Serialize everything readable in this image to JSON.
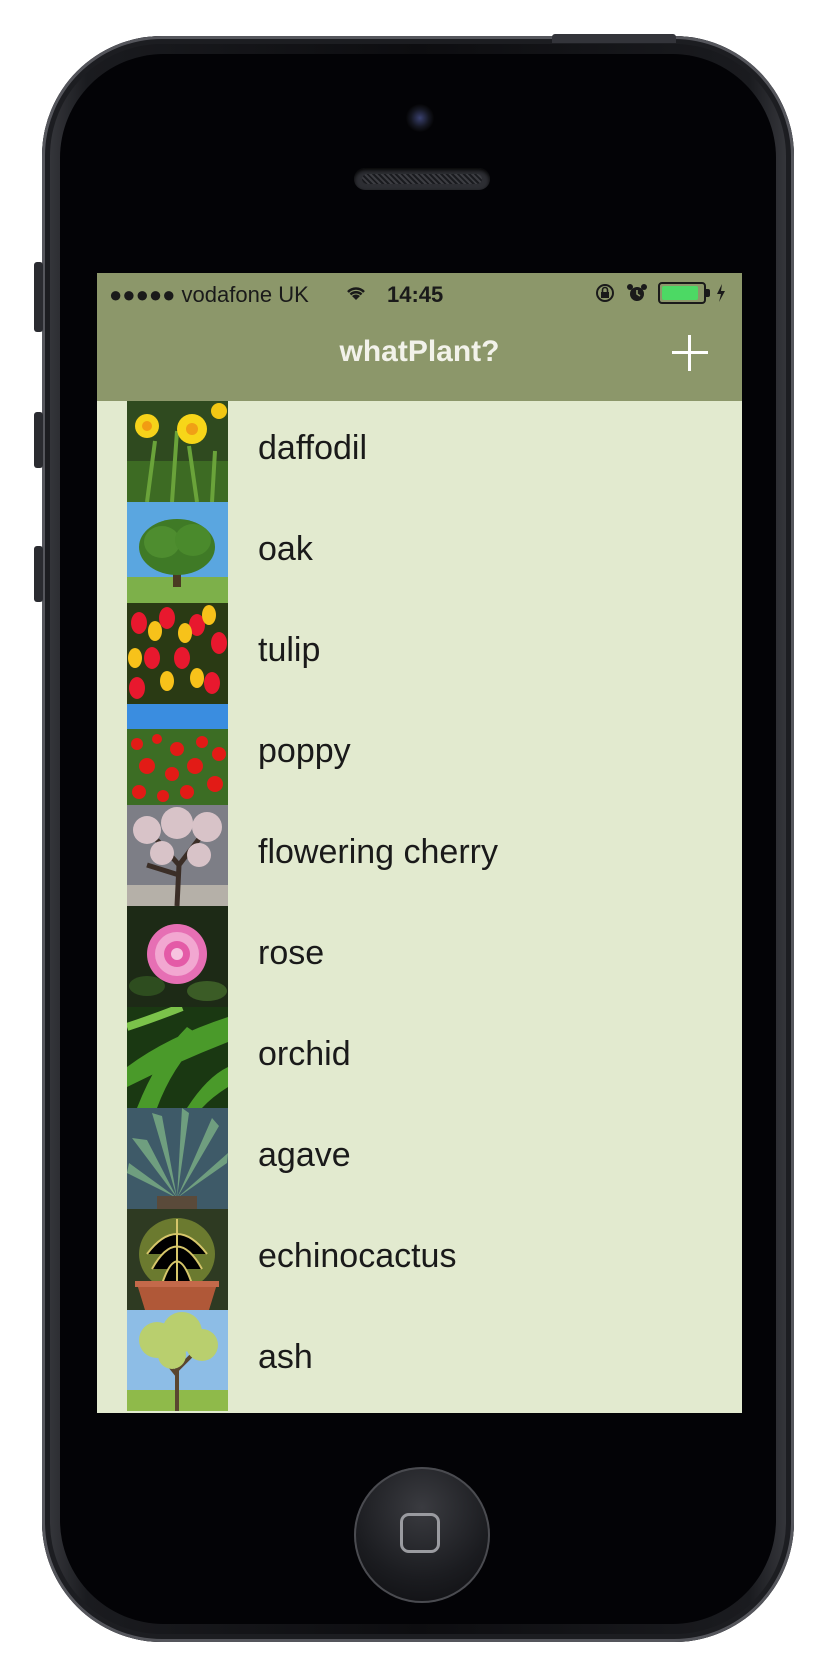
{
  "status_bar": {
    "carrier": "●●●●● vodafone UK",
    "time": "14:45",
    "battery_level": 0.9
  },
  "nav": {
    "title": "whatPlant?",
    "add_icon": "plus-icon"
  },
  "colors": {
    "bar": "#8c976a",
    "list_bg": "#e2eacf",
    "battery_green": "#4cd964"
  },
  "plants": [
    {
      "label": "daffodil",
      "icon": "daffodil-photo"
    },
    {
      "label": "oak",
      "icon": "oak-photo"
    },
    {
      "label": "tulip",
      "icon": "tulip-photo"
    },
    {
      "label": "poppy",
      "icon": "poppy-photo"
    },
    {
      "label": "flowering cherry",
      "icon": "flowering-cherry-photo"
    },
    {
      "label": "rose",
      "icon": "rose-photo"
    },
    {
      "label": "orchid",
      "icon": "orchid-photo"
    },
    {
      "label": "agave",
      "icon": "agave-photo"
    },
    {
      "label": "echinocactus",
      "icon": "echinocactus-photo"
    },
    {
      "label": "ash",
      "icon": "ash-photo"
    }
  ]
}
